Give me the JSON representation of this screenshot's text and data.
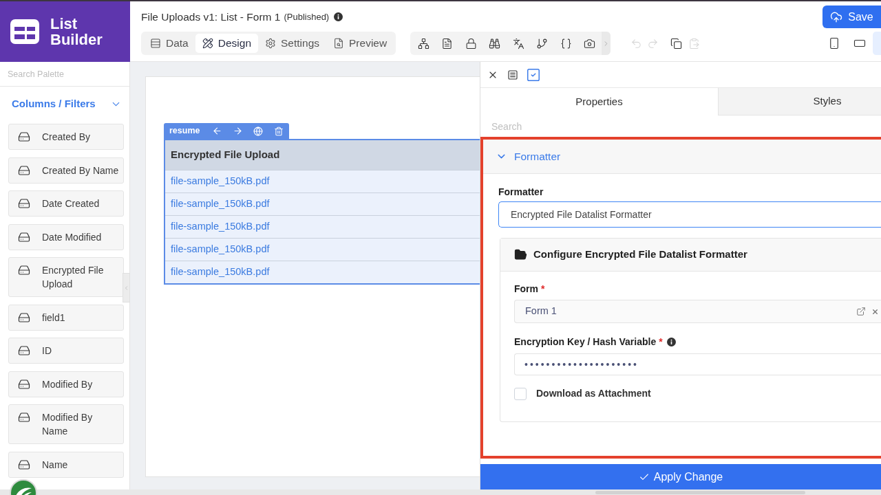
{
  "logo": {
    "title": "List Builder"
  },
  "header": {
    "title": "File Uploads v1: List - Form 1",
    "status": "(Published)",
    "save_button": {
      "label": "Save"
    }
  },
  "mode_tabs": [
    {
      "label": "Data",
      "selected": false
    },
    {
      "label": "Design",
      "selected": true
    },
    {
      "label": "Settings",
      "selected": false
    },
    {
      "label": "Preview",
      "selected": false
    }
  ],
  "edit_actions": [
    {
      "disabled": true
    },
    {
      "disabled": true
    },
    {
      "disabled": false
    },
    {
      "disabled": true
    }
  ],
  "device_buttons": [
    {
      "selected": false
    },
    {
      "selected": false
    },
    {
      "selected": true
    }
  ],
  "palette": {
    "search_placeholder": "Search Palette",
    "section": {
      "title": "Columns / Filters",
      "expanded": true,
      "items": [
        "Created By",
        "Created By Name",
        "Date Created",
        "Date Modified",
        "Encrypted File Upload",
        "field1",
        "ID",
        "Modified By",
        "Modified By Name",
        "Name"
      ]
    }
  },
  "canvas": {
    "column_toolbar": {
      "label": "resume"
    },
    "table": {
      "column": "Encrypted File Upload",
      "rows": [
        "file-sample_150kB.pdf",
        "file-sample_150kB.pdf",
        "file-sample_150kB.pdf",
        "file-sample_150kB.pdf",
        "file-sample_150kB.pdf"
      ]
    }
  },
  "panel": {
    "tabs": [
      {
        "label": "Properties",
        "selected": true
      },
      {
        "label": "Styles",
        "selected": false
      }
    ],
    "search_placeholder": "Search",
    "section": {
      "title": "Formatter",
      "expanded": true,
      "formatter": {
        "label": "Formatter",
        "value": "Encrypted File Datalist Formatter"
      },
      "config": {
        "title": "Configure Encrypted File Datalist Formatter",
        "fields": [
          {
            "kind": "select",
            "label": "Form",
            "required_mark": "*",
            "help": false,
            "value": "Form 1"
          },
          {
            "kind": "password",
            "label": "Encryption Key / Hash Variable",
            "required_mark": "*",
            "help": true,
            "value": "•••••••••••••••••••••"
          }
        ],
        "checkbox": {
          "label": "Download as Attachment",
          "checked": false
        }
      }
    },
    "apply_button": {
      "label": "Apply Change"
    }
  }
}
